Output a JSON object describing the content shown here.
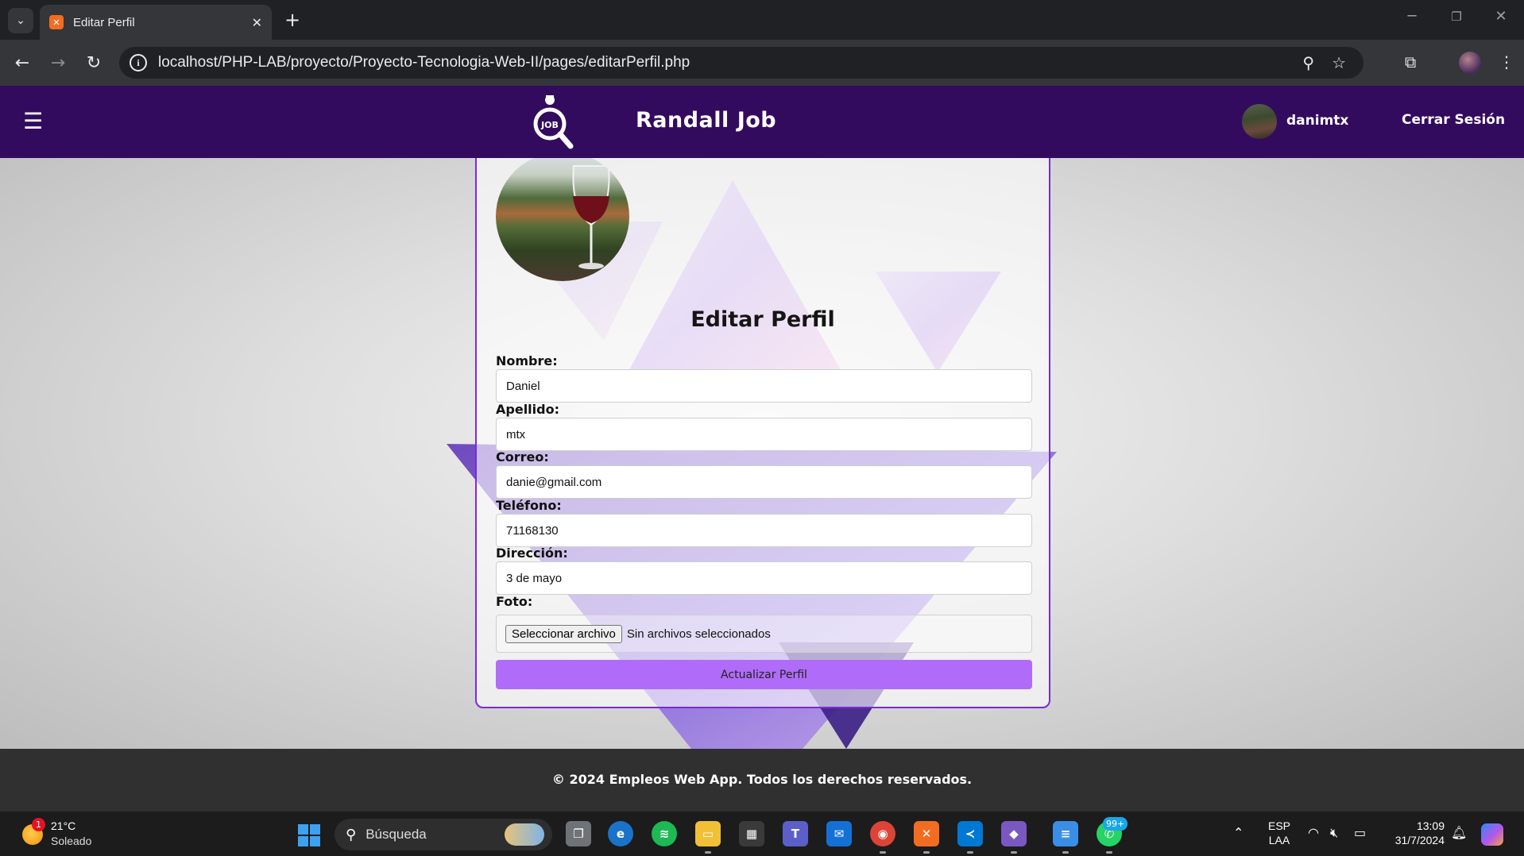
{
  "browser": {
    "tab_title": "Editar Perfil",
    "url": "localhost/PHP-LAB/proyecto/Proyecto-Tecnologia-Web-II/pages/editarPerfil.php"
  },
  "header": {
    "logo_text": "JOB",
    "title": "Randall Job",
    "username": "danimtx",
    "logout_label": "Cerrar Sesión"
  },
  "form": {
    "title": "Editar Perfil",
    "fields": [
      {
        "label": "Nombre:",
        "value": "Daniel"
      },
      {
        "label": "Apellido:",
        "value": "mtx"
      },
      {
        "label": "Correo:",
        "value": "danie@gmail.com"
      },
      {
        "label": "Teléfono:",
        "value": "71168130"
      },
      {
        "label": "Dirección:",
        "value": "3 de mayo"
      }
    ],
    "photo_label": "Foto:",
    "file_button": "Seleccionar archivo",
    "file_status": "Sin archivos seleccionados",
    "submit_label": "Actualizar Perfil"
  },
  "footer": {
    "text": "© 2024 Empleos Web App. Todos los derechos reservados."
  },
  "taskbar": {
    "weather_badge": "1",
    "temperature": "21°C",
    "condition": "Soleado",
    "search_placeholder": "Búsqueda",
    "whatsapp_badge": "99+",
    "lang_top": "ESP",
    "lang_bottom": "LAA",
    "time": "13:09",
    "date": "31/7/2024"
  },
  "colors": {
    "header_bg": "#330b5e",
    "card_border": "#7a2bd6",
    "submit_bg": "#b06cf8",
    "footer_bg": "#303030"
  }
}
